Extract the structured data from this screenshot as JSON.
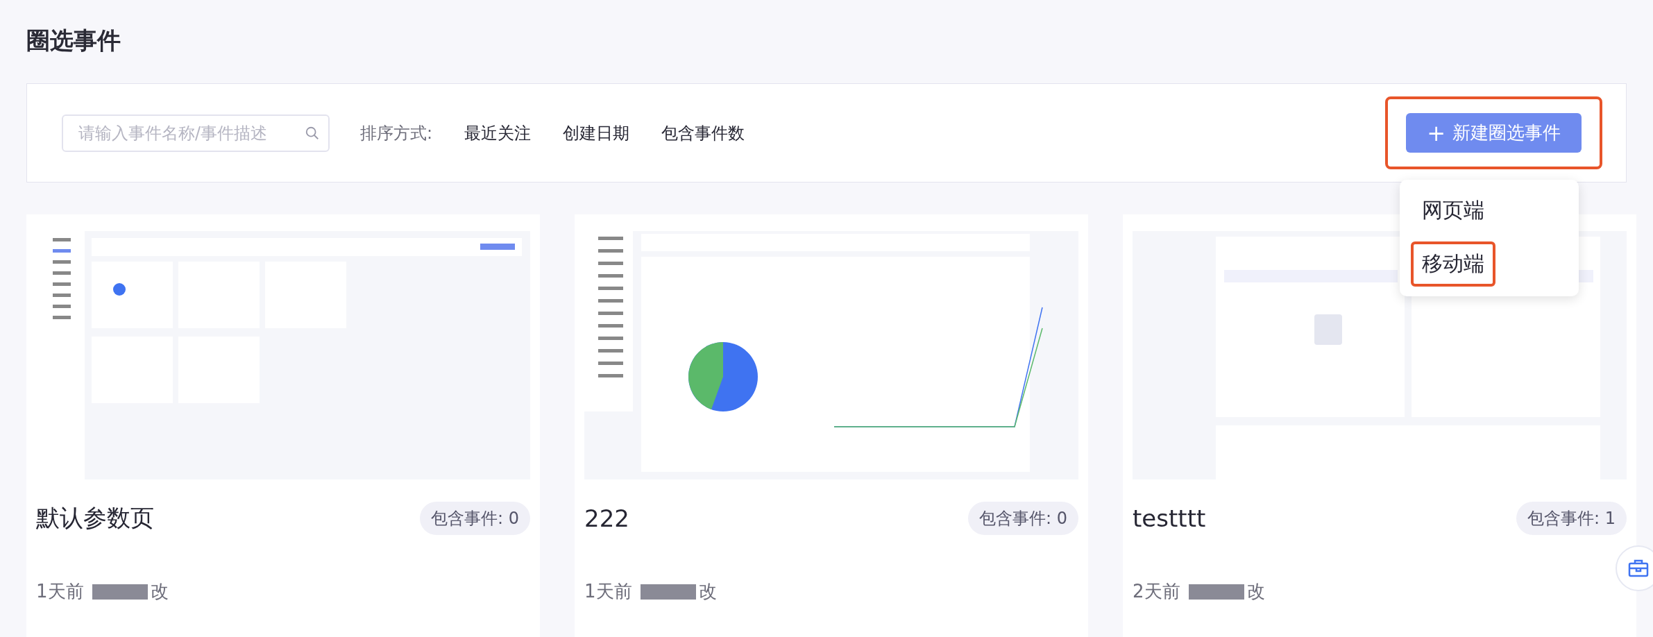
{
  "page_title": "圈选事件",
  "toolbar": {
    "search": {
      "placeholder": "请输入事件名称/事件描述"
    },
    "sort_label": "排序方式:",
    "sort_options": [
      {
        "label": "最近关注",
        "selected": false
      },
      {
        "label": "创建日期",
        "selected": false
      },
      {
        "label": "包含事件数",
        "selected": false
      }
    ],
    "create_button": {
      "icon": "+",
      "label": "新建圈选事件",
      "highlighted": true
    },
    "create_menu": [
      {
        "label": "网页端",
        "highlighted": false
      },
      {
        "label": "移动端",
        "highlighted": true
      }
    ]
  },
  "cards": [
    {
      "title": "默认参数页",
      "badge": "包含事件: 0",
      "modified_prefix": "1天前",
      "modified_suffix": "改",
      "kind": "event-list"
    },
    {
      "title": "222",
      "badge": "包含事件: 0",
      "modified_prefix": "1天前",
      "modified_suffix": "改",
      "kind": "dashboard"
    },
    {
      "title": "testttt",
      "badge": "包含事件: 1",
      "modified_prefix": "2天前",
      "modified_suffix": "改",
      "kind": "tables"
    }
  ]
}
